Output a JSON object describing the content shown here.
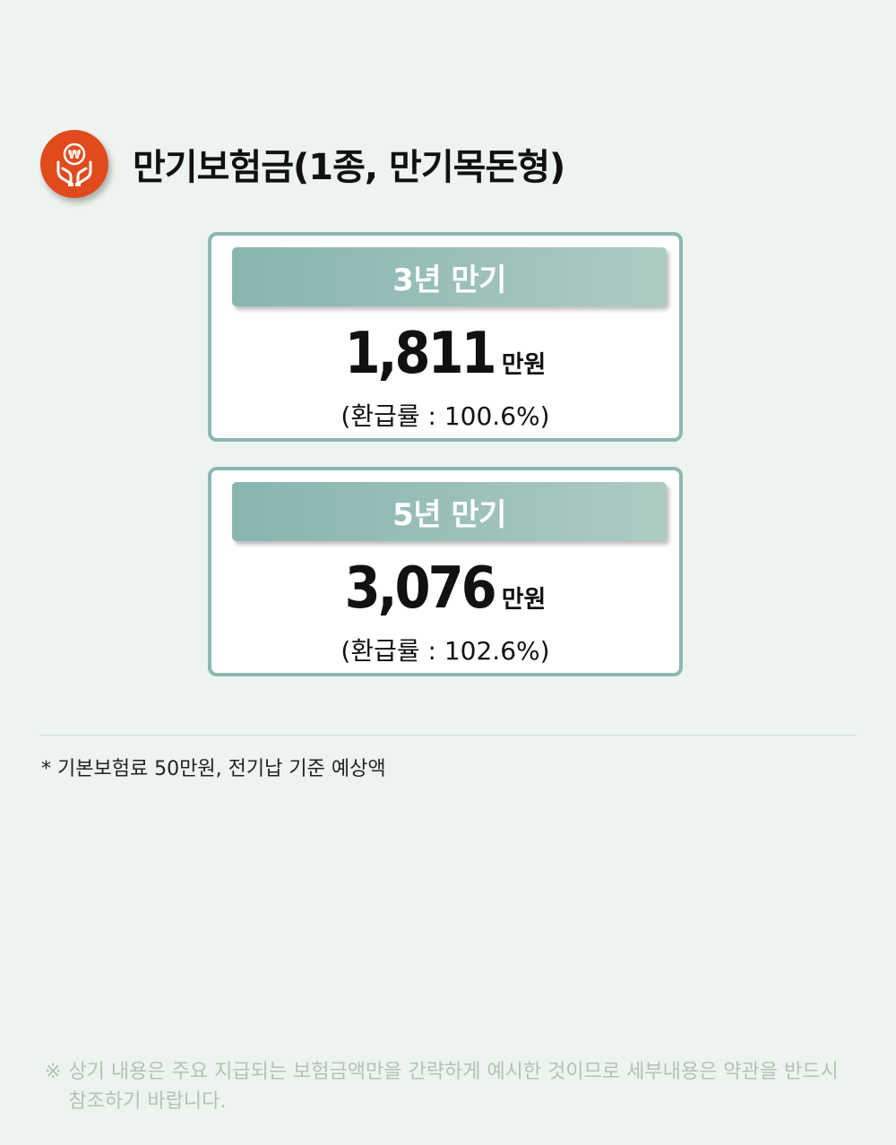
{
  "header": {
    "title": "만기보험금(1종, 만기목돈형)",
    "icon": "won-hands-icon",
    "icon_symbol": "₩",
    "accent_color": "#e04a1c"
  },
  "cards": [
    {
      "label": "3년 만기",
      "amount": "1,811",
      "unit": "만원",
      "rate": "(환급률 : 100.6%)"
    },
    {
      "label": "5년 만기",
      "amount": "3,076",
      "unit": "만원",
      "rate": "(환급률 : 102.6%)"
    }
  ],
  "footnote": "* 기본보험료 50만원, 전기납 기준 예상액",
  "disclaimer": {
    "mark": "※",
    "text": "상기 내용은 주요 지급되는 보험금액만을 간략하게 예시한 것이므로 세부내용은 약관을 반드시 참조하기 바랍니다."
  }
}
